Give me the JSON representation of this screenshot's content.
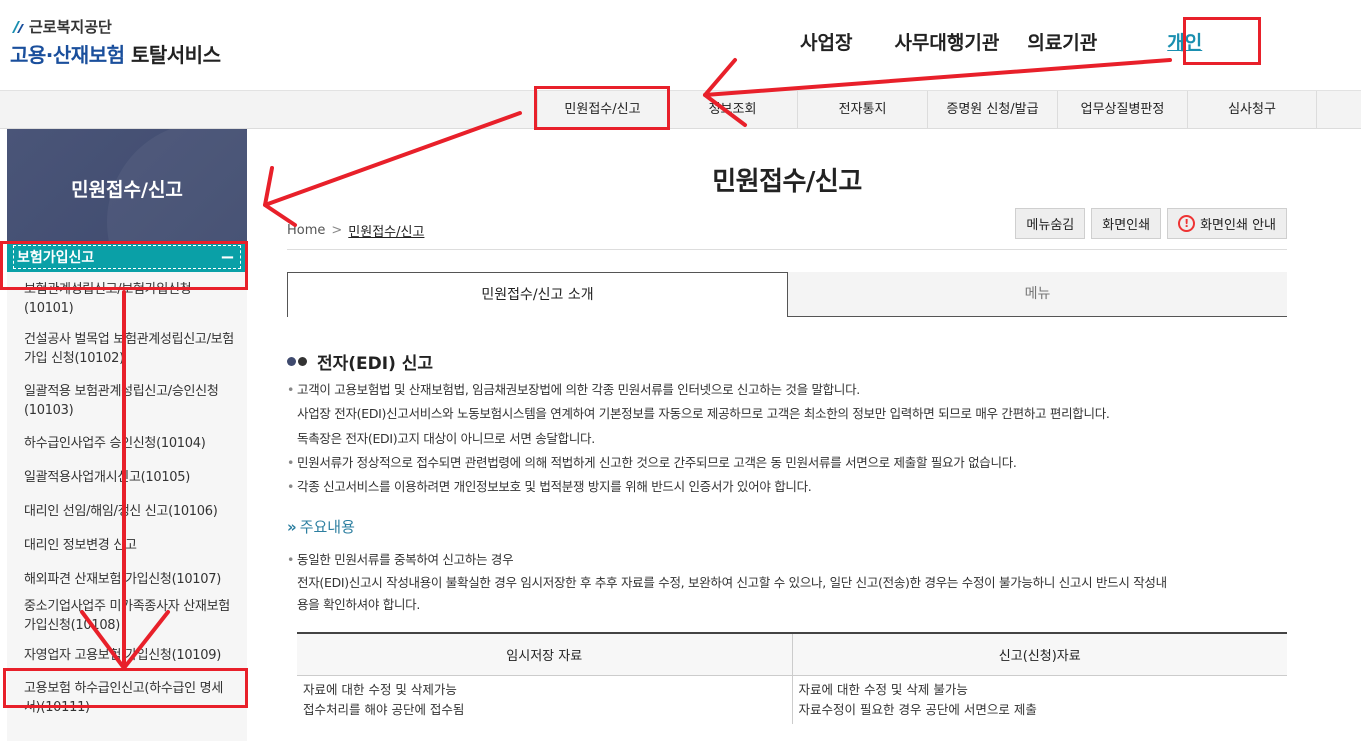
{
  "header": {
    "logo_org": "근로복지공단",
    "logo_title_blue": "고용·산재보험",
    "logo_title_dark": "토탈서비스",
    "nav": [
      "사업장",
      "사무대행기관",
      "의료기관",
      "개인"
    ]
  },
  "gnb": {
    "items": [
      "민원접수/신고",
      "정보조회",
      "전자통지",
      "증명원 신청/발급",
      "업무상질병판정",
      "심사청구"
    ]
  },
  "sidebar": {
    "title": "민원접수/신고",
    "category": "보험가입신고",
    "category_toggle": "−",
    "items": [
      "보험관계성립신고/보험가입신청(10101)",
      "건설공사 벌목업 보험관계성립신고/보험가입 신청(10102)",
      "일괄적용 보험관계성립신고/승인신청(10103)",
      "하수급인사업주 승인신청(10104)",
      "일괄적용사업개시신고(10105)",
      "대리인 선임/해임/갱신 신고(10106)",
      "대리인 정보변경 신고",
      "해외파견 산재보험 가입신청(10107)",
      "중소기업사업주 미가족종사자 산재보험가입신청(10108)",
      "자영업자 고용보험 가입신청(10109)",
      "고용보험 하수급인신고(하수급인 명세서)(10111)"
    ]
  },
  "main": {
    "title": "민원접수/신고",
    "breadcrumb_home": "Home",
    "breadcrumb_current": "민원접수/신고",
    "btn_hide_menu": "메뉴숨김",
    "btn_print": "화면인쇄",
    "btn_print_guide": "화면인쇄 안내",
    "tab_intro": "민원접수/신고 소개",
    "tab_menu": "메뉴",
    "section_title": "전자(EDI) 신고",
    "para1": "고객이 고용보험법 및 산재보험법, 임금채권보장법에 의한 각종 민원서류를 인터넷으로 신고하는 것을 말합니다.",
    "para2": "사업장 전자(EDI)신고서비스와 노동보험시스템을 연계하여 기본정보를 자동으로 제공하므로 고객은 최소한의 정보만 입력하면 되므로 매우 간편하고 편리합니다.",
    "para3": "독촉장은 전자(EDI)고지 대상이 아니므로 서면 송달합니다.",
    "para4": "민원서류가 정상적으로 접수되면 관련법령에 의해 적법하게 신고한 것으로 간주되므로 고객은 동 민원서류를 서면으로 제출할 필요가 없습니다.",
    "para5": "각종 신고서비스를 이용하려면 개인정보보호 및 법적분쟁 방지를 위해 반드시 인증서가 있어야 합니다.",
    "sub_title": "주요내용",
    "sub_para1": "동일한 민원서류를 중복하여 신고하는 경우",
    "sub_para2": "전자(EDI)신고시 작성내용이 불확실한 경우 임시저장한 후 추후 자료를 수정, 보완하여 신고할 수 있으나, 일단 신고(전송)한 경우는 수정이 불가능하니 신고시 반드시 작성내",
    "sub_para3": "용을 확인하셔야 합니다.",
    "table": {
      "headers": [
        "임시저장 자료",
        "신고(신청)자료"
      ],
      "rows": [
        [
          "자료에 대한 수정 및 삭제가능",
          "자료에 대한 수정 및 삭제 불가능"
        ],
        [
          "접수처리를 해야 공단에 접수됨",
          "자료수정이 필요한 경우 공단에 서면으로 제출"
        ]
      ]
    }
  },
  "colors": {
    "annotation_red": "#e8202a",
    "sidebar_head": "#4a5578",
    "category_teal": "#0aa0a7",
    "accent_link": "#1a8fb0"
  }
}
